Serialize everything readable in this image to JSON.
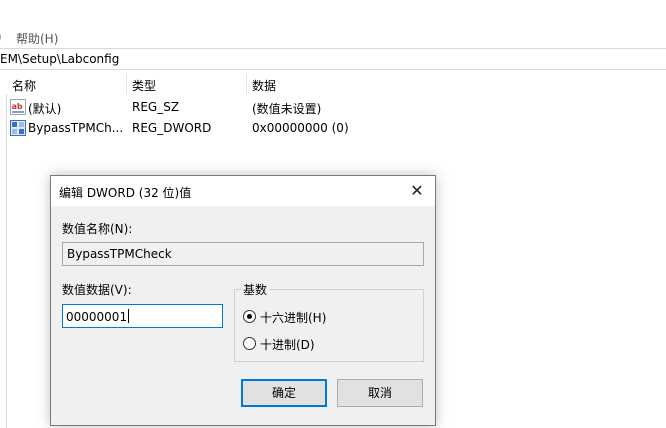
{
  "menubar": {
    "partial": ")",
    "help_label": "帮助(H)"
  },
  "address_path": "EM\\Setup\\Labconfig",
  "columns": {
    "name": "名称",
    "type": "类型",
    "data": "数据"
  },
  "rows": [
    {
      "name": "(默认)",
      "type": "REG_SZ",
      "data": "(数值未设置)",
      "icon": "string-value-icon"
    },
    {
      "name": "BypassTPMCh...",
      "type": "REG_DWORD",
      "data": "0x00000000 (0)",
      "icon": "dword-value-icon"
    }
  ],
  "dialog": {
    "title": "编辑 DWORD (32 位)值",
    "name_label": "数值名称(N):",
    "name_value": "BypassTPMCheck",
    "data_label": "数值数据(V):",
    "data_value": "00000001",
    "base_label": "基数",
    "hex_label": "十六进制(H)",
    "dec_label": "十进制(D)",
    "selected_base": "hex",
    "ok_label": "确定",
    "cancel_label": "取消"
  },
  "colors": {
    "accent": "#0078d7",
    "dialog_bg": "#f0f0f0"
  }
}
